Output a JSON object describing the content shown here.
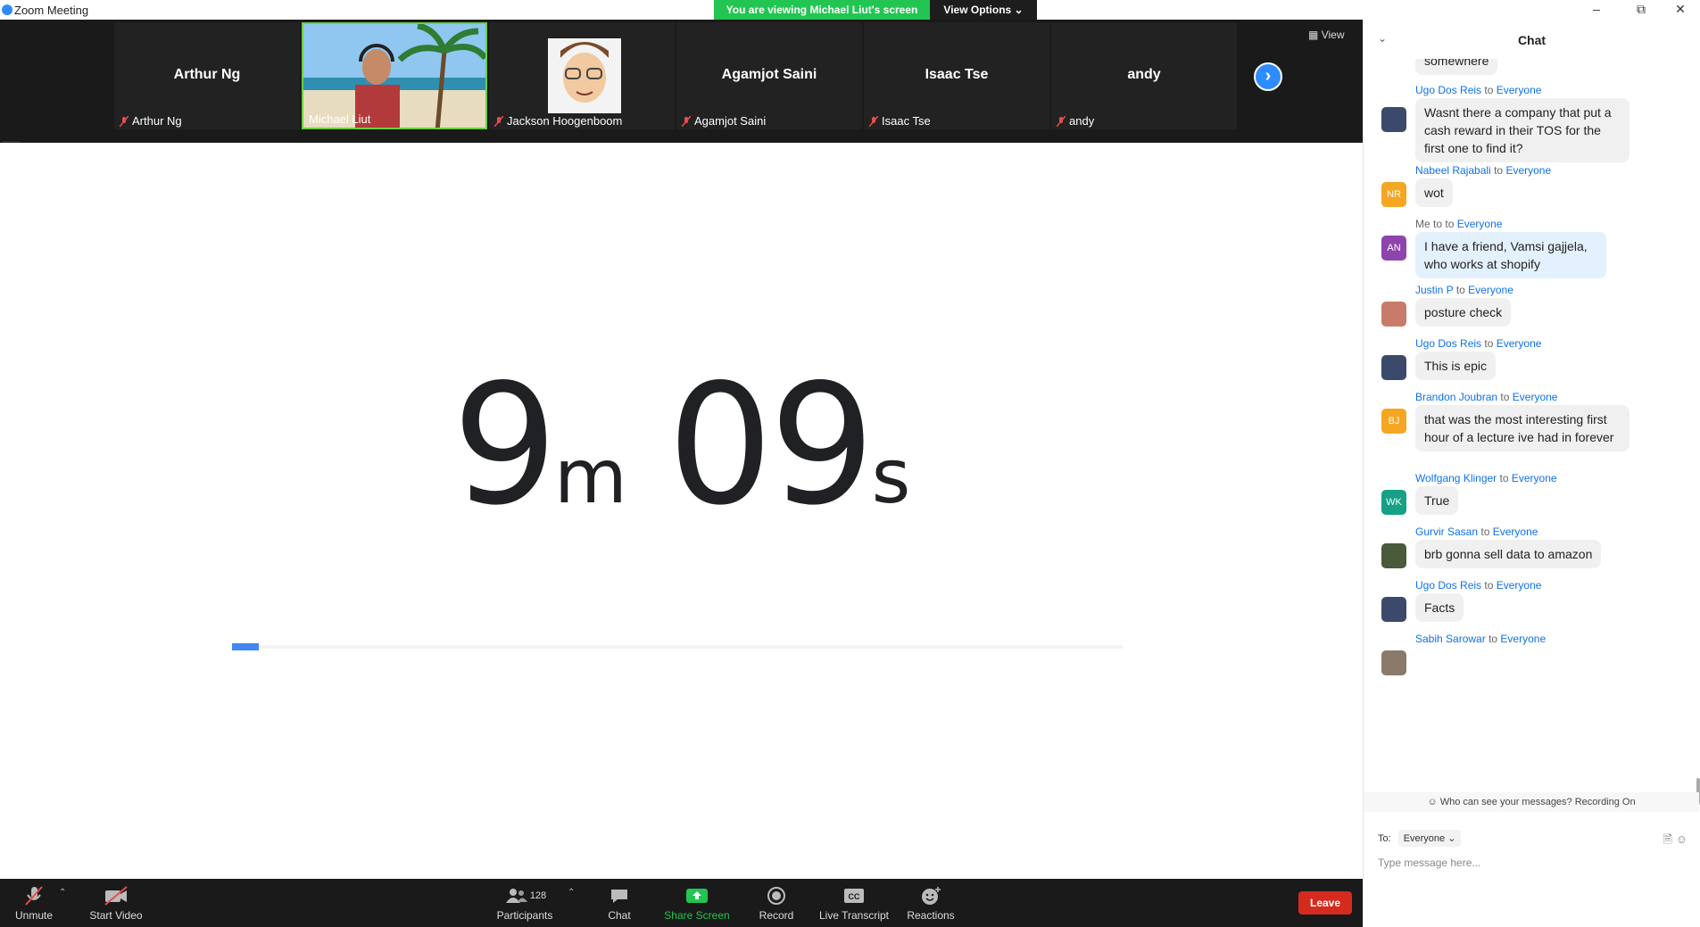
{
  "window": {
    "title": "Zoom Meeting"
  },
  "banner": {
    "viewing": "You are viewing Michael Liut's screen",
    "view_options": "View Options ⌄"
  },
  "strip": {
    "tiles": [
      {
        "big": "Arthur Ng",
        "label": "Arthur Ng"
      },
      {
        "big": "",
        "label": "Michael Liut"
      },
      {
        "big": "",
        "label": "Jackson Hoogenboom"
      },
      {
        "big": "Agamjot Saini",
        "label": "Agamjot Saini"
      },
      {
        "big": "Isaac Tse",
        "label": "Isaac Tse"
      },
      {
        "big": "andy",
        "label": "andy"
      }
    ],
    "view_label": "View"
  },
  "timer": {
    "minutes": "9",
    "min_unit": "m",
    "seconds": "09",
    "sec_unit": "s",
    "progress": 0.03
  },
  "chat": {
    "title": "Chat",
    "messages": [
      {
        "sender": "",
        "to": "",
        "recipient": "",
        "text": "somewhere",
        "initials": "",
        "avatar_color": ""
      },
      {
        "sender": "Ugo Dos Reis",
        "to": "to",
        "recipient": "Everyone",
        "text": "Wasnt there a company that put a cash reward in their TOS for the first one to find it?",
        "initials": "",
        "avatar_color": "#3b4a6b"
      },
      {
        "sender": "Nabeel Rajabali",
        "to": "to",
        "recipient": "Everyone",
        "text": "wot",
        "initials": "NR",
        "avatar_color": "#f5a623"
      },
      {
        "sender": "Me to",
        "to": "to",
        "recipient": "Everyone",
        "text": "I have a friend, Vamsi gajjela, who works at shopify",
        "initials": "AN",
        "avatar_color": "#8e44ad"
      },
      {
        "sender": "Justin P",
        "to": "to",
        "recipient": "Everyone",
        "text": "posture check",
        "initials": "",
        "avatar_color": "#c97b6b"
      },
      {
        "sender": "Ugo Dos Reis",
        "to": "to",
        "recipient": "Everyone",
        "text": "This is epic",
        "initials": "",
        "avatar_color": "#3b4a6b"
      },
      {
        "sender": "Brandon Joubran",
        "to": "to",
        "recipient": "Everyone",
        "text": "that was the most interesting first hour of a lecture ive had in forever",
        "initials": "BJ",
        "avatar_color": "#f5a623"
      },
      {
        "sender": "Wolfgang Klinger",
        "to": "to",
        "recipient": "Everyone",
        "text": "True",
        "initials": "WK",
        "avatar_color": "#16a085"
      },
      {
        "sender": "Gurvir Sasan",
        "to": "to",
        "recipient": "Everyone",
        "text": "brb gonna sell data to amazon",
        "initials": "",
        "avatar_color": "#4a5a3a"
      },
      {
        "sender": "Ugo Dos Reis",
        "to": "to",
        "recipient": "Everyone",
        "text": "Facts",
        "initials": "",
        "avatar_color": "#3b4a6b"
      },
      {
        "sender": "Sabih Sarowar",
        "to": "to",
        "recipient": "Everyone",
        "text": "",
        "initials": "",
        "avatar_color": "#8a7a6a"
      }
    ],
    "recording_note": "Who can see your messages? Recording On",
    "to_label": "To:",
    "to_value": "Everyone ⌄",
    "input_placeholder": "Type message here..."
  },
  "toolbar": {
    "unmute": "Unmute",
    "start_video": "Start Video",
    "participants": "Participants",
    "participant_count": "128",
    "chat": "Chat",
    "share_screen": "Share Screen",
    "record": "Record",
    "live_transcript": "Live Transcript",
    "reactions": "Reactions",
    "leave": "Leave"
  },
  "colors": {
    "share_green": "#23c552",
    "zoom_blue": "#2d8cff",
    "leave_red": "#d52b1e",
    "progress_blue": "#4285f4"
  }
}
